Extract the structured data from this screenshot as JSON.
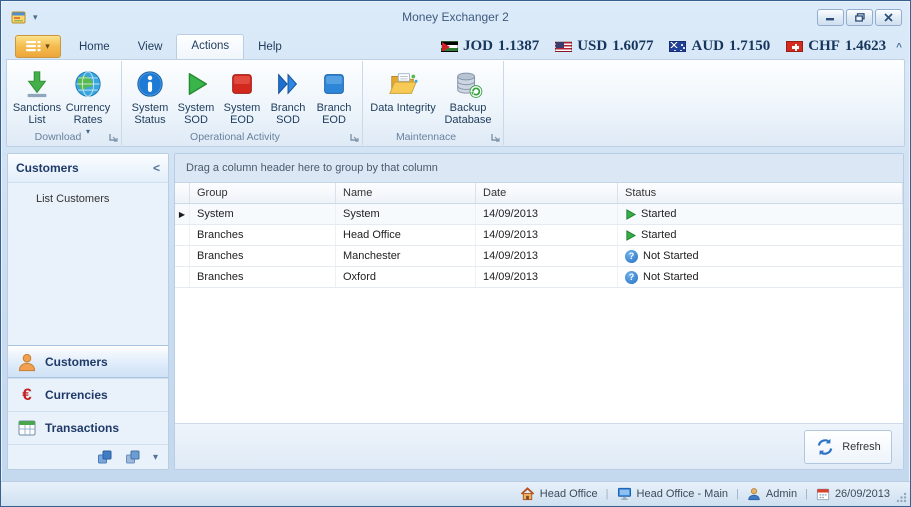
{
  "window": {
    "title": "Money Exchanger 2"
  },
  "icons": {
    "caret_down": "▾",
    "collapse_left": "<",
    "collapse_ribbon": "^",
    "row_pointer": "▶",
    "question_mark": "?",
    "separator": "|",
    "euro": "€",
    "names": [
      "app-icon",
      "minimize-icon",
      "restore-icon",
      "close-icon",
      "jordan-flag",
      "usa-flag",
      "australia-flag",
      "switzerland-flag",
      "download-icon",
      "globe-icon",
      "info-icon",
      "play-icon",
      "stop-icon",
      "double-chevron-icon",
      "square-icon",
      "folder-icon",
      "database-icon",
      "dialog-launcher-icon",
      "person-icon",
      "euro-icon",
      "table-icon",
      "cubes-icon",
      "refresh-icon",
      "home-icon",
      "monitor-icon",
      "user-icon",
      "calendar-icon",
      "resize-grip-icon"
    ]
  },
  "ribbon": {
    "tabs": [
      {
        "label": "Home"
      },
      {
        "label": "View"
      },
      {
        "label": "Actions"
      },
      {
        "label": "Help"
      }
    ],
    "active_tab": "Actions",
    "ticker": [
      {
        "code": "JOD",
        "rate": "1.1387"
      },
      {
        "code": "USD",
        "rate": "1.6077"
      },
      {
        "code": "AUD",
        "rate": "1.7150"
      },
      {
        "code": "CHF",
        "rate": "1.4623"
      }
    ],
    "groups": [
      {
        "label": "Download",
        "buttons": [
          {
            "label": "Sanctions List"
          },
          {
            "label": "Currency Rates"
          }
        ]
      },
      {
        "label": "Operational Activity",
        "buttons": [
          {
            "label": "System Status"
          },
          {
            "label": "System SOD"
          },
          {
            "label": "System EOD"
          },
          {
            "label": "Branch SOD"
          },
          {
            "label": "Branch EOD"
          }
        ]
      },
      {
        "label": "Maintennace",
        "buttons": [
          {
            "label": "Data Integrity"
          },
          {
            "label": "Backup Database"
          }
        ]
      }
    ]
  },
  "sidebar": {
    "title": "Customers",
    "items": [
      {
        "label": "List Customers"
      }
    ],
    "nav": [
      {
        "label": "Customers",
        "selected": true
      },
      {
        "label": "Currencies",
        "selected": false
      },
      {
        "label": "Transactions",
        "selected": false
      }
    ]
  },
  "grid": {
    "group_hint": "Drag a column header here to group by that column",
    "columns": [
      {
        "label": "Group"
      },
      {
        "label": "Name"
      },
      {
        "label": "Date"
      },
      {
        "label": "Status"
      }
    ],
    "rows": [
      {
        "group": "System",
        "name": "System",
        "date": "14/09/2013",
        "status": "Started",
        "status_state": "started"
      },
      {
        "group": "Branches",
        "name": "Head Office",
        "date": "14/09/2013",
        "status": "Started",
        "status_state": "started"
      },
      {
        "group": "Branches",
        "name": "Manchester",
        "date": "14/09/2013",
        "status": "Not Started",
        "status_state": "not-started"
      },
      {
        "group": "Branches",
        "name": "Oxford",
        "date": "14/09/2013",
        "status": "Not Started",
        "status_state": "not-started"
      }
    ],
    "refresh_label": "Refresh"
  },
  "statusbar": {
    "branch": "Head Office",
    "workstation": "Head Office - Main",
    "user": "Admin",
    "date": "26/09/2013"
  }
}
